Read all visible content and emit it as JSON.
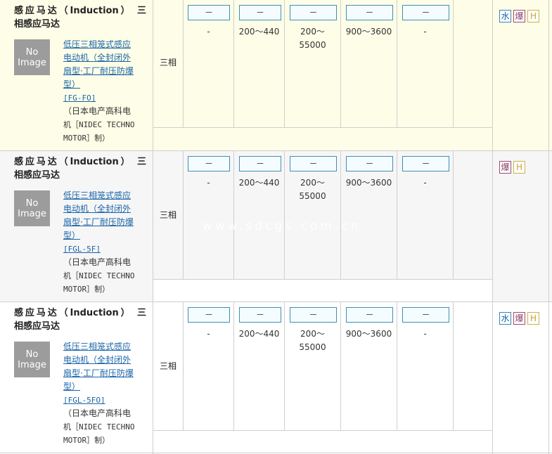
{
  "rows": [
    {
      "title_line1": "感应马达（Induction） 三",
      "title_line2": "相感应马达",
      "noimage_l1": "No",
      "noimage_l2": "Image",
      "desc_l1": "低压三相笼式感应",
      "desc_l2": "电动机（全封闭外",
      "desc_l3": "扇型·工厂耐压防爆",
      "desc_l4": "型）",
      "code": "[FG-FO]",
      "maker_l1": "（日本电产高科电",
      "maker_l2": "机［NIDEC TECHNO",
      "maker_l3": "MOTOR］制）",
      "phase": "三相",
      "inputs": [
        "－",
        "－",
        "－",
        "－",
        "－"
      ],
      "val1": "-",
      "val2": "200～440",
      "val3a": "200～",
      "val3b": "55000",
      "val4": "900～3600",
      "val5": "-",
      "badges": [
        "水",
        "爆",
        "H"
      ]
    },
    {
      "title_line1": "感应马达（Induction） 三",
      "title_line2": "相感应马达",
      "noimage_l1": "No",
      "noimage_l2": "Image",
      "desc_l1": "低压三相笼式感应",
      "desc_l2": "电动机（全封闭外",
      "desc_l3": "扇型·工厂耐压防爆",
      "desc_l4": "型）",
      "code": "[FGL-5F]",
      "maker_l1": "（日本电产高科电",
      "maker_l2": "机［NIDEC TECHNO",
      "maker_l3": "MOTOR］制）",
      "phase": "三相",
      "inputs": [
        "－",
        "－",
        "－",
        "－",
        "－"
      ],
      "val1": "-",
      "val2": "200～440",
      "val3a": "200～",
      "val3b": "55000",
      "val4": "900～3600",
      "val5": "-",
      "badges": [
        "爆",
        "H"
      ]
    },
    {
      "title_line1": "感应马达（Induction） 三",
      "title_line2": "相感应马达",
      "noimage_l1": "No",
      "noimage_l2": "Image",
      "desc_l1": "低压三相笼式感应",
      "desc_l2": "电动机（全封闭外",
      "desc_l3": "扇型·工厂耐压防爆",
      "desc_l4": "型）",
      "code": "[FGL-5FO]",
      "maker_l1": "（日本电产高科电",
      "maker_l2": "机［NIDEC TECHNO",
      "maker_l3": "MOTOR］制）",
      "phase": "三相",
      "inputs": [
        "－",
        "－",
        "－",
        "－",
        "－"
      ],
      "val1": "-",
      "val2": "200～440",
      "val3a": "200～",
      "val3b": "55000",
      "val4": "900～3600",
      "val5": "-",
      "badges": [
        "水",
        "爆",
        "H"
      ]
    }
  ],
  "watermark": "www.sdcgs.com.cn",
  "colors": {
    "row1_bg": "#fefee8",
    "row2_bg": "#f6f6f6",
    "row3_bg": "#ffffff",
    "link": "#1a64a8",
    "input_border": "#3c8fb8"
  }
}
